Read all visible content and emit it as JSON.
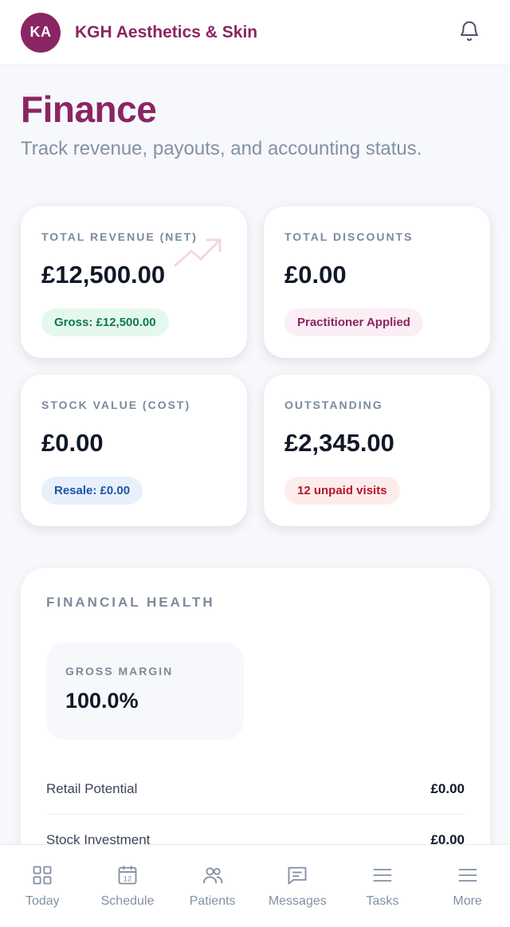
{
  "header": {
    "avatar_initials": "KA",
    "brand": "KGH Aesthetics & Skin",
    "bell_icon": "bell-icon"
  },
  "page": {
    "title": "Finance",
    "subtitle": "Track revenue, payouts, and accounting status."
  },
  "stats": [
    {
      "label": "TOTAL REVENUE (NET)",
      "value": "£12,500.00",
      "pill": "Gross: £12,500.00",
      "pill_color": "#0e7a4a"
    },
    {
      "label": "TOTAL DISCOUNTS",
      "value": "£0.00",
      "pill": "Practitioner Applied",
      "pill_color": "#8a2563"
    },
    {
      "label": "STOCK VALUE (COST)",
      "value": "£0.00",
      "pill": "Resale: £0.00",
      "pill_color": "#1b56a8"
    },
    {
      "label": "OUTSTANDING",
      "value": "£2,345.00",
      "pill": "12 unpaid visits",
      "pill_color": "#b8142a"
    }
  ],
  "health": {
    "title": "FINANCIAL HEALTH",
    "margin_label": "GROSS MARGIN",
    "margin_value": "100.0%",
    "rows": [
      {
        "label": "Retail Potential",
        "value": "£0.00"
      },
      {
        "label": "Stock Investment",
        "value": "£0.00"
      }
    ]
  },
  "nav": [
    {
      "label": "Today",
      "icon": "grid-icon"
    },
    {
      "label": "Schedule",
      "icon": "calendar-icon",
      "icon_text": "12"
    },
    {
      "label": "Patients",
      "icon": "users-icon"
    },
    {
      "label": "Messages",
      "icon": "message-icon"
    },
    {
      "label": "Tasks",
      "icon": "menu-icon"
    },
    {
      "label": "More",
      "icon": "menu-icon"
    }
  ],
  "colors": {
    "brand": "#8a2563",
    "background": "#f6f8fb"
  }
}
